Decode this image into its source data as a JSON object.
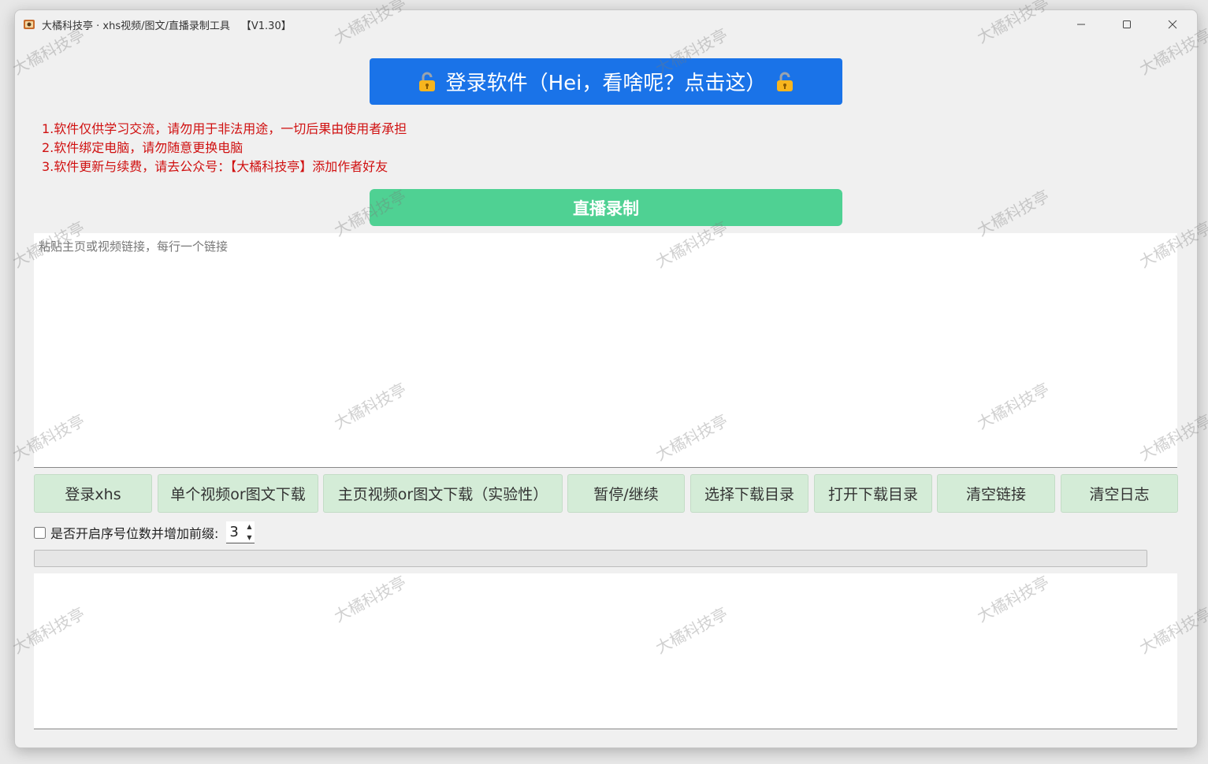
{
  "window": {
    "title": "大橘科技亭 · xhs视频/图文/直播录制工具",
    "version": "【V1.30】"
  },
  "login_button": {
    "label": "登录软件（Hei，看啥呢？点击这）"
  },
  "notices": [
    "1.软件仅供学习交流，请勿用于非法用途，一切后果由使用者承担",
    "2.软件绑定电脑，请勿随意更换电脑",
    "3.软件更新与续费，请去公众号：【大橘科技亭】添加作者好友"
  ],
  "live_button": {
    "label": "直播录制"
  },
  "links_input": {
    "placeholder": "粘贴主页或视频链接，每行一个链接",
    "value": ""
  },
  "actions": [
    {
      "label": "登录xhs"
    },
    {
      "label": "单个视频or图文下载"
    },
    {
      "label": "主页视频or图文下载（实验性）"
    },
    {
      "label": "暂停/继续"
    },
    {
      "label": "选择下载目录"
    },
    {
      "label": "打开下载目录"
    },
    {
      "label": "清空链接"
    },
    {
      "label": "清空日志"
    }
  ],
  "prefix_option": {
    "label": "是否开启序号位数并增加前缀:",
    "checked": false,
    "digits": "3"
  },
  "progress": {
    "value": 0
  },
  "watermark": {
    "text": "大橘科技亭"
  },
  "colors": {
    "login_button": "#1a73e8",
    "live_button": "#4fd193",
    "action_button": "#d4ecd7",
    "notice_text": "#d01010"
  }
}
